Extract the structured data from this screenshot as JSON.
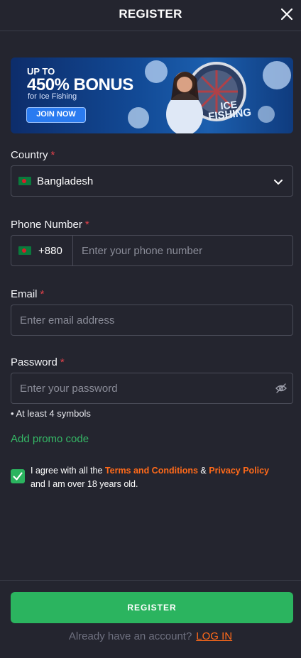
{
  "header": {
    "title": "REGISTER"
  },
  "banner": {
    "line1": "UP TO",
    "line2": "450% BONUS",
    "line3": "for Ice Fishing",
    "cta": "JOIN NOW",
    "logo_line1": "ICE",
    "logo_line2": "FISHING"
  },
  "country": {
    "label": "Country",
    "required_mark": "*",
    "value": "Bangladesh",
    "flag": "bangladesh-flag"
  },
  "phone": {
    "label": "Phone Number",
    "required_mark": "*",
    "code": "+880",
    "placeholder": "Enter your phone number"
  },
  "email": {
    "label": "Email",
    "required_mark": "*",
    "placeholder": "Enter email address"
  },
  "password": {
    "label": "Password",
    "required_mark": "*",
    "placeholder": "Enter your password",
    "hint": "• At least 4 symbols"
  },
  "promo": {
    "label": "Add promo code"
  },
  "agree": {
    "checked": true,
    "text_before": "I agree with all the ",
    "terms": "Terms and Conditions",
    "amp": " & ",
    "privacy": "Privacy Policy",
    "text_after": " and I am over 18 years old."
  },
  "footer": {
    "register_label": "REGISTER",
    "already_text": "Already have an account?",
    "login_label": "LOG IN"
  },
  "colors": {
    "accent_green": "#2bb45f",
    "link_orange": "#ff6a1a",
    "background": "#24252f",
    "required_red": "#e0414a"
  }
}
